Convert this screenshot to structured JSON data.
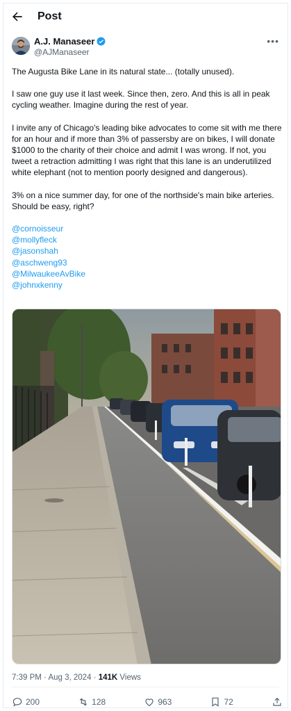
{
  "header": {
    "title": "Post",
    "back_icon": "arrow-left-icon"
  },
  "author": {
    "name": "A.J. Manaseer",
    "handle": "@AJManaseer",
    "verified_color": "#1d9bf0"
  },
  "tweet": {
    "paragraphs": [
      "The Augusta Bike Lane in its natural state... (totally unused).",
      "I saw one guy use it last week. Since then, zero. And this is all in peak cycling weather. Imagine during the rest of year.",
      "I invite any of Chicago's leading bike advocates to come sit with me there for an hour and if more than 3% of passersby are on bikes, I will donate $1000 to the charity of their choice and admit I was wrong. If not, you tweet a retraction admitting I was right that this lane is an underutilized white elephant (not to mention poorly designed and dangerous).",
      "3% on a nice summer day, for one of the northside's main bike arteries. Should be easy, right?"
    ],
    "mentions": [
      "@cornoisseur",
      "@mollyfleck",
      "@jasonshah",
      "@aschweng93",
      "@MilwaukeeAvBike",
      "@johnxkenny"
    ]
  },
  "meta": {
    "time": "7:39 PM",
    "separator": "·",
    "date": "Aug 3, 2024",
    "views_count": "141K",
    "views_label": "Views"
  },
  "actions": {
    "replies": "200",
    "reposts": "128",
    "likes": "963",
    "bookmarks": "72"
  },
  "colors": {
    "link": "#1d9bf0",
    "muted": "#536471",
    "text": "#0f1419"
  }
}
